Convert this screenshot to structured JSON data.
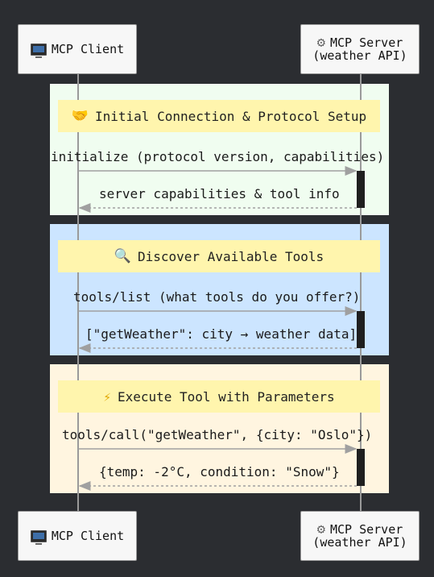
{
  "colors": {
    "background": "#2b2d31",
    "actor_fill": "#f7f7f7",
    "lifeline": "#9a9a9a",
    "note_fill": "#fff5ad",
    "activation": "#1f1f1f",
    "section_1": "#f0fdf0",
    "section_2": "#cce5ff",
    "section_3": "#fff5e0"
  },
  "actors": {
    "client": {
      "label": "MCP Client",
      "icon": "monitor-icon"
    },
    "server": {
      "label_line1": "MCP Server",
      "label_line2": "(weather API)",
      "icon": "gear-icon"
    }
  },
  "sections": [
    {
      "note": "Initial Connection & Protocol Setup",
      "note_icon": "handshake-icon",
      "request": "initialize (protocol version, capabilities)",
      "response": "server capabilities & tool info"
    },
    {
      "note": "Discover Available Tools",
      "note_icon": "magnifier-icon",
      "request": "tools/list (what tools do you offer?)",
      "response": "[\"getWeather\": city → weather data]"
    },
    {
      "note": "Execute Tool with Parameters",
      "note_icon": "lightning-icon",
      "request": "tools/call(\"getWeather\", {city: \"Oslo\"})",
      "response": "{temp: -2°C, condition: \"Snow\"}"
    }
  ]
}
